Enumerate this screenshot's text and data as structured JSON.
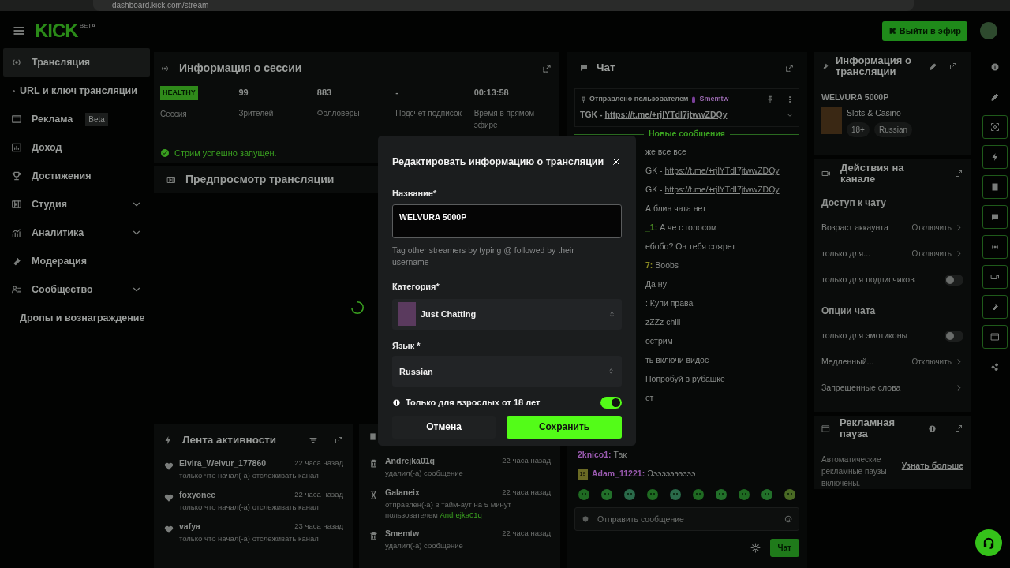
{
  "browser": {
    "url": "dashboard.kick.com/stream"
  },
  "header": {
    "logo": "KICK",
    "logo_tag": "BETA",
    "go_live": "Выйти в эфир"
  },
  "sidebar": {
    "items": [
      {
        "label": "Трансляция",
        "kind": "main",
        "selected": true
      },
      {
        "label": "URL и ключ трансляции",
        "kind": "sub",
        "dot": true,
        "selected": false
      },
      {
        "label": "Реклама",
        "kind": "main",
        "badge": "Beta",
        "selected": false
      },
      {
        "label": "Доход",
        "kind": "main",
        "selected": false
      },
      {
        "label": "Достижения",
        "kind": "main",
        "selected": false
      },
      {
        "label": "Студия",
        "kind": "main",
        "expandable": true,
        "selected": false
      },
      {
        "label": "Аналитика",
        "kind": "main",
        "expandable": true,
        "selected": false
      },
      {
        "label": "Модерация",
        "kind": "main",
        "selected": false
      },
      {
        "label": "Сообщество",
        "kind": "main",
        "expandable": true,
        "selected": false
      },
      {
        "label": "Дропы и вознаграждение",
        "kind": "sub",
        "dot": false,
        "selected": false
      }
    ]
  },
  "session": {
    "title": "Информация о сессии",
    "stats": [
      {
        "value": "HEALTHY",
        "label": "Сессия",
        "kind": "badge"
      },
      {
        "value": "99",
        "label": "Зрителей",
        "kind": "number"
      },
      {
        "value": "883",
        "label": "Фолловеры",
        "kind": "number"
      },
      {
        "value": "-",
        "label": "Подсчет подписок",
        "kind": "number"
      },
      {
        "value": "00:13:58",
        "label": "Время в прямом эфире",
        "kind": "number"
      }
    ],
    "status": "Стрим успешно запущен."
  },
  "preview": {
    "title": "Предпросмотр трансляции"
  },
  "activity": {
    "title": "Лента активности",
    "items": [
      {
        "user": "Elvira_Welvur_177860",
        "time": "22 часа назад",
        "text": "только что начал(-а) отслеживать канал"
      },
      {
        "user": "foxyonee",
        "time": "22 часа назад",
        "text": "только что начал(-а) отслеживать канал"
      },
      {
        "user": "vafya",
        "time": "23 часа назад",
        "text": "только что начал(-а) отслеживать канал"
      }
    ]
  },
  "moderators": {
    "items": [
      {
        "user": "Andrejka01q",
        "time": "22 часа назад",
        "text": "удалил(-а) сообщение",
        "kind": "delete"
      },
      {
        "user": "Galaneix",
        "time": "22 часа назад",
        "text": "отправлен(-а) в тайм-аут на 5 минут пользователем",
        "by": "Andrejka01q",
        "kind": "timeout"
      },
      {
        "user": "Smemtw",
        "time": "22 часа назад",
        "text": "удалил(-а) сообщение",
        "kind": "delete"
      }
    ]
  },
  "chat": {
    "title": "Чат",
    "pinned": {
      "by_label": "Отправлено пользователем",
      "by": "Smemtw",
      "text": "TGK -",
      "link": "https://t.me/+rjlYTdI7jtwwZDQy"
    },
    "divider": "Новые сообщения",
    "messages_behind_dialog": [
      {
        "text": "же все все"
      },
      {
        "text": "GK -",
        "link": "https://t.me/+rjlYTdI7jtwwZDQy"
      },
      {
        "text": "GK -",
        "link": "https://t.me/+rjlYTdI7jtwwZDQy"
      },
      {
        "text": "А блин чата нет"
      },
      {
        "user": "_1:",
        "color": "#4a8a22",
        "text": "А че с голосом"
      },
      {
        "text": "ебобо? Он тебя сожрет"
      },
      {
        "user": "7:",
        "color": "#8a8a22",
        "text": "Boobs"
      },
      {
        "text": "Да ну"
      },
      {
        "text": ": Купи права"
      },
      {
        "text": "zZZz chill"
      },
      {
        "text": "острим"
      },
      {
        "text": "ть включи видос"
      },
      {
        "text": "Попробуй в рубашке"
      },
      {
        "text": "ет"
      }
    ],
    "messages": [
      {
        "user": "2knico1:",
        "color": "#9a5ab0",
        "text": "Так"
      },
      {
        "badge": "19",
        "user": "Adam_11221:",
        "color": "#9a5ab0",
        "text": "Эээээээээээ"
      }
    ],
    "input_placeholder": "Отправить сообщение",
    "send": "Чат"
  },
  "stream_info": {
    "title": "Информация о трансляции",
    "stream_title": "WELVURA 5000P",
    "category": "Slots & Casino",
    "tags": [
      "18+",
      "Russian"
    ]
  },
  "actions": {
    "title": "Действия на канале",
    "sections": [
      {
        "heading": "Доступ к чату",
        "rows": [
          {
            "label": "Возраст аккаунта",
            "kind": "select",
            "value": "Отключить"
          },
          {
            "label": "только для...",
            "kind": "select",
            "value": "Отключить"
          },
          {
            "label": "только для подписчиков",
            "kind": "toggle",
            "on": false
          }
        ]
      },
      {
        "heading": "Опции чата",
        "rows": [
          {
            "label": "только для эмотиконы",
            "kind": "toggle",
            "on": false
          },
          {
            "label": "Медленный...",
            "kind": "select",
            "value": "Отключить"
          },
          {
            "label": "Запрещенные слова",
            "kind": "link"
          }
        ]
      }
    ]
  },
  "ad_break": {
    "title": "Рекламная пауза",
    "text": "Автоматические рекламные паузы включены.",
    "link": "Узнать больше"
  },
  "toolbar": [
    {
      "boxed": false
    },
    {
      "boxed": false
    },
    {
      "boxed": true
    },
    {
      "boxed": true
    },
    {
      "boxed": true
    },
    {
      "boxed": true
    },
    {
      "boxed": true
    },
    {
      "boxed": true
    },
    {
      "boxed": true
    },
    {
      "boxed": true
    },
    {
      "boxed": false
    }
  ],
  "modal": {
    "title": "Редактировать информацию о трансляции",
    "name_label": "Название*",
    "name_value": "WELVURA 5000P",
    "hint": "Tag other streamers by typing @ followed by their username",
    "category_label": "Категория*",
    "category_value": "Just Chatting",
    "language_label": "Язык *",
    "language_value": "Russian",
    "adult_label": "Только для взрослых от 18 лет",
    "adult_on": true,
    "cancel": "Отмена",
    "save": "Сохранить"
  }
}
